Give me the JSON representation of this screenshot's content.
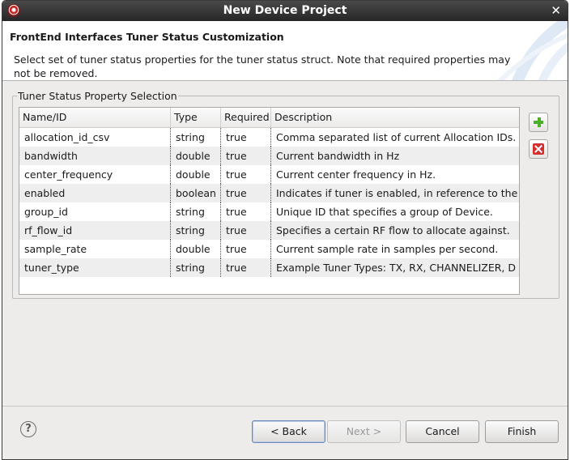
{
  "window": {
    "title": "New Device Project"
  },
  "header": {
    "title": "FrontEnd Interfaces Tuner Status Customization",
    "description": "Select set of tuner status properties for the tuner status struct.  Note that required properties may not be removed."
  },
  "group": {
    "label": "Tuner Status Property Selection"
  },
  "table": {
    "columns": [
      "Name/ID",
      "Type",
      "Required",
      "Description"
    ],
    "rows": [
      [
        "allocation_id_csv",
        "string",
        "true",
        "Comma separated list of current Allocation IDs."
      ],
      [
        "bandwidth",
        "double",
        "true",
        "Current bandwidth in Hz"
      ],
      [
        "center_frequency",
        "double",
        "true",
        "Current center frequency in Hz."
      ],
      [
        "enabled",
        "boolean",
        "true",
        "Indicates if tuner is enabled, in reference to the outp"
      ],
      [
        "group_id",
        "string",
        "true",
        "Unique ID that specifies a group of Device."
      ],
      [
        "rf_flow_id",
        "string",
        "true",
        "Specifies a certain RF flow to allocate against."
      ],
      [
        "sample_rate",
        "double",
        "true",
        "Current sample rate in samples per second."
      ],
      [
        "tuner_type",
        "string",
        "true",
        "Example Tuner Types: TX, RX, CHANNELIZER, D"
      ]
    ]
  },
  "buttons": {
    "back": "< Back",
    "next": "Next >",
    "cancel": "Cancel",
    "finish": "Finish"
  },
  "icons": {
    "help": "help-icon",
    "add": "plus-icon",
    "remove": "remove-icon",
    "close": "close-icon",
    "app": "app-icon"
  },
  "colors": {
    "add_icon": "#4caf2a",
    "remove_icon": "#d32f2f",
    "titlebar": "#2f2f2f"
  }
}
